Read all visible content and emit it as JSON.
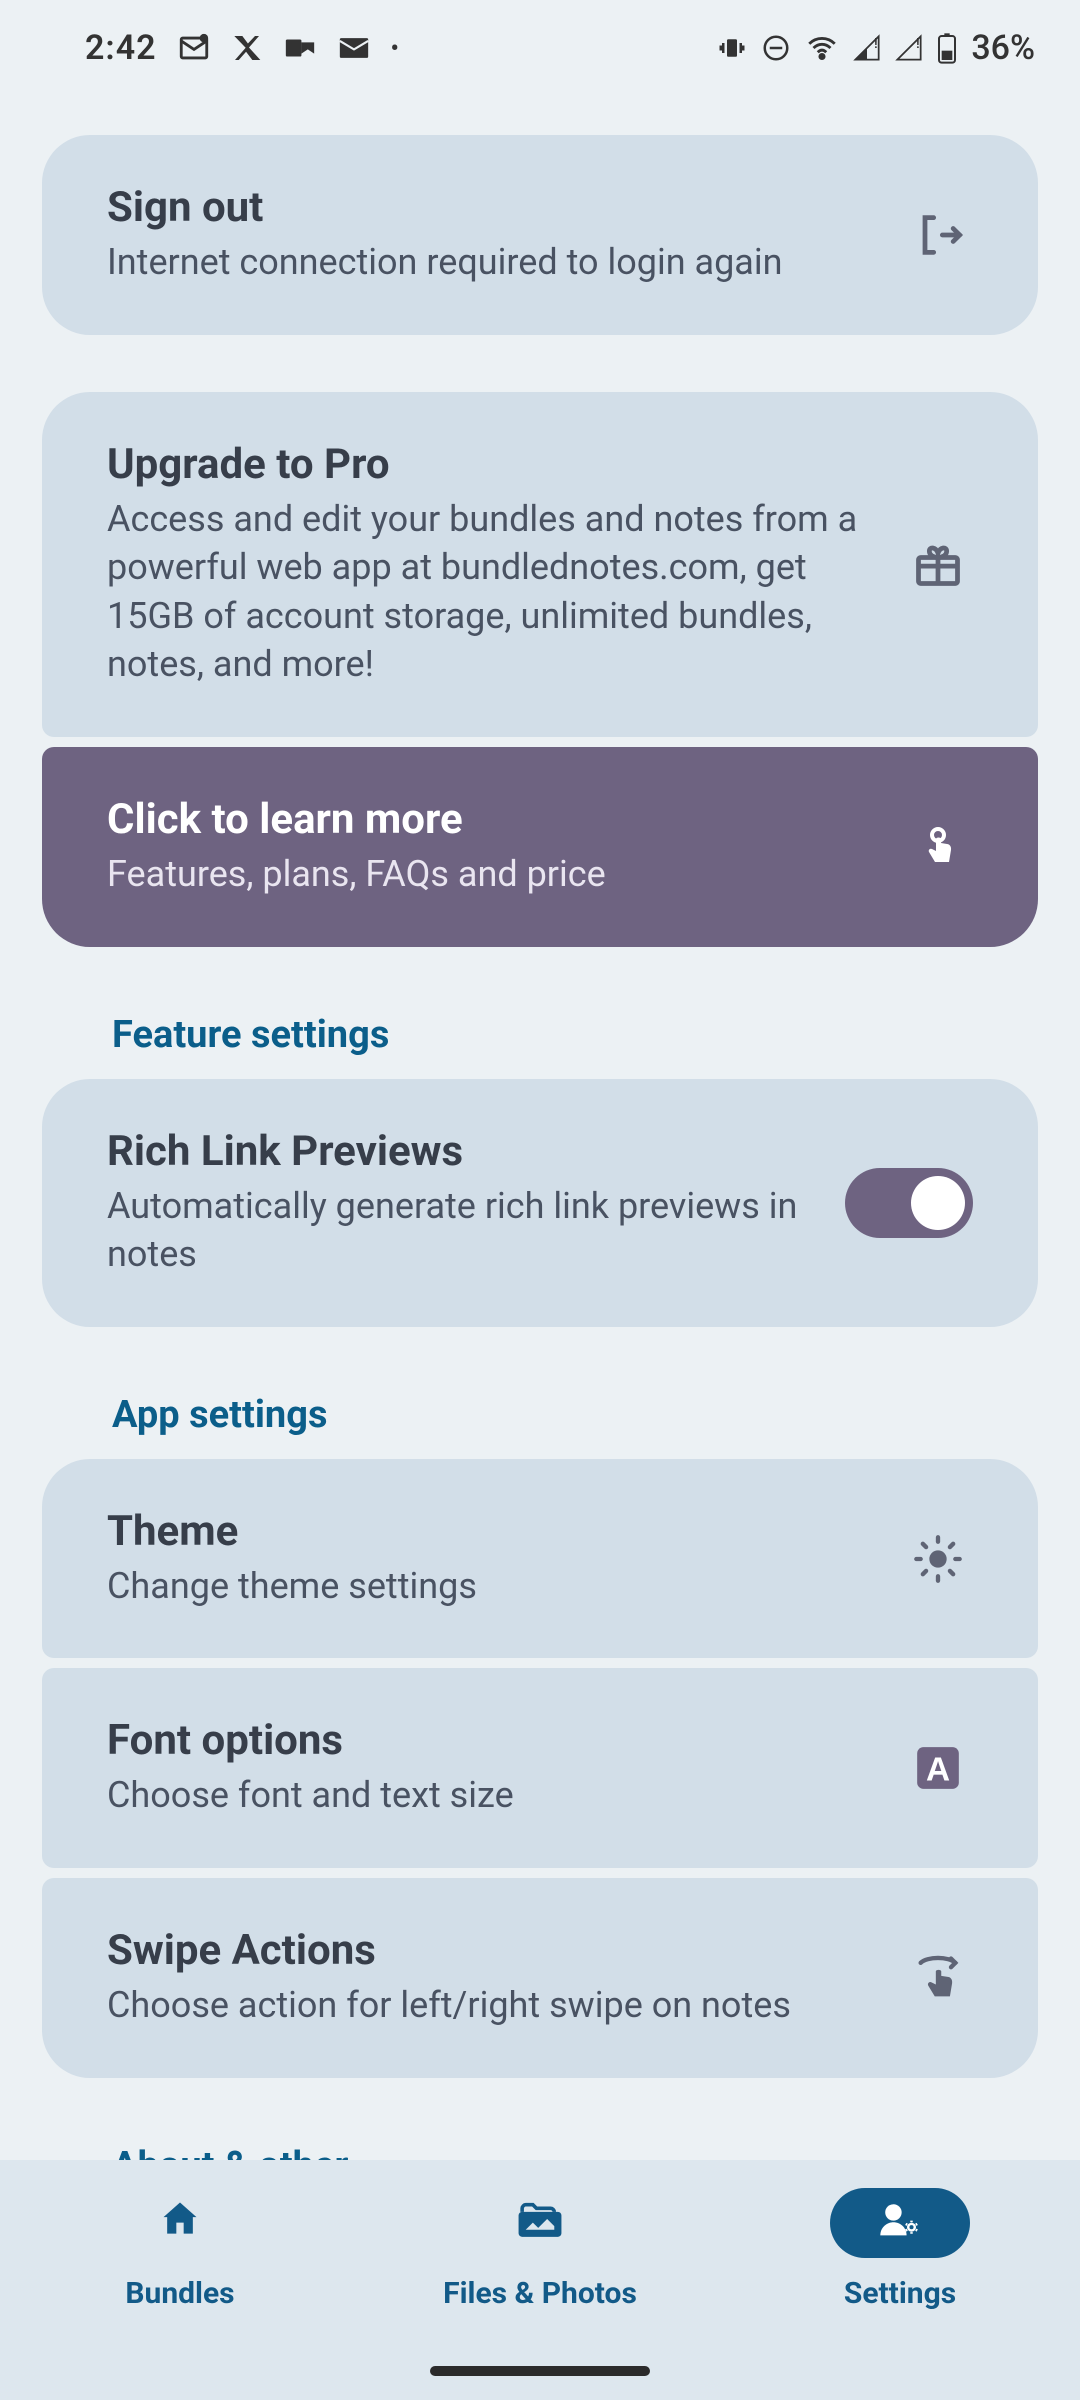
{
  "status": {
    "time": "2:42",
    "battery": "36%"
  },
  "cards": {
    "signout": {
      "title": "Sign out",
      "sub": "Internet connection required to login again"
    },
    "upgrade": {
      "title": "Upgrade to Pro",
      "sub": "Access and edit your bundles and notes from a powerful web app at bundlednotes.com, get 15GB of account storage, unlimited bundles, notes, and more!"
    },
    "learn": {
      "title": "Click to learn more",
      "sub": "Features, plans, FAQs and price"
    },
    "richlink": {
      "title": "Rich Link Previews",
      "sub": "Automatically generate rich link previews in notes",
      "enabled": true
    },
    "theme": {
      "title": "Theme",
      "sub": "Change theme settings"
    },
    "font": {
      "title": "Font options",
      "sub": "Choose font and text size"
    },
    "swipe": {
      "title": "Swipe Actions",
      "sub": "Choose action for left/right swipe on notes"
    }
  },
  "sections": {
    "feature": "Feature settings",
    "app": "App settings",
    "about": "About & other"
  },
  "nav": {
    "bundles": "Bundles",
    "files": "Files & Photos",
    "settings": "Settings"
  }
}
